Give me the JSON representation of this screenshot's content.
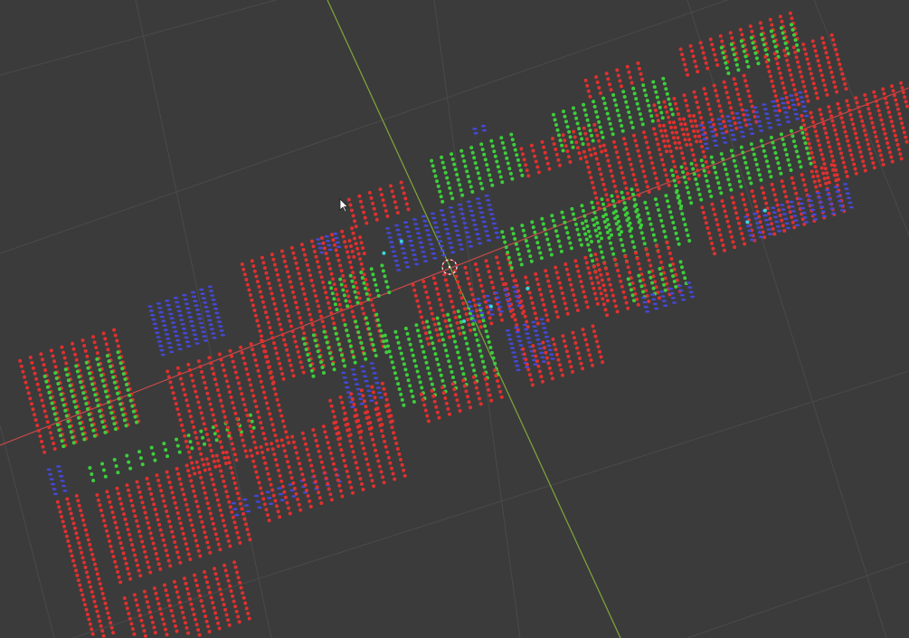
{
  "viewport": {
    "mode": "3D viewport",
    "background_color": "#3b3b3b",
    "grid_color": "#4a4a4a",
    "axes": {
      "x_color": "#c94a4a",
      "y_color": "#7fa83a"
    },
    "point_colors": {
      "red": "#e0302e",
      "green": "#3ccf3a",
      "blue": "#4448d8",
      "cyan": "#3fd6d6"
    },
    "icons": {
      "pivot": "3d-cursor-icon",
      "pointer": "mouse-cursor-icon"
    }
  }
}
